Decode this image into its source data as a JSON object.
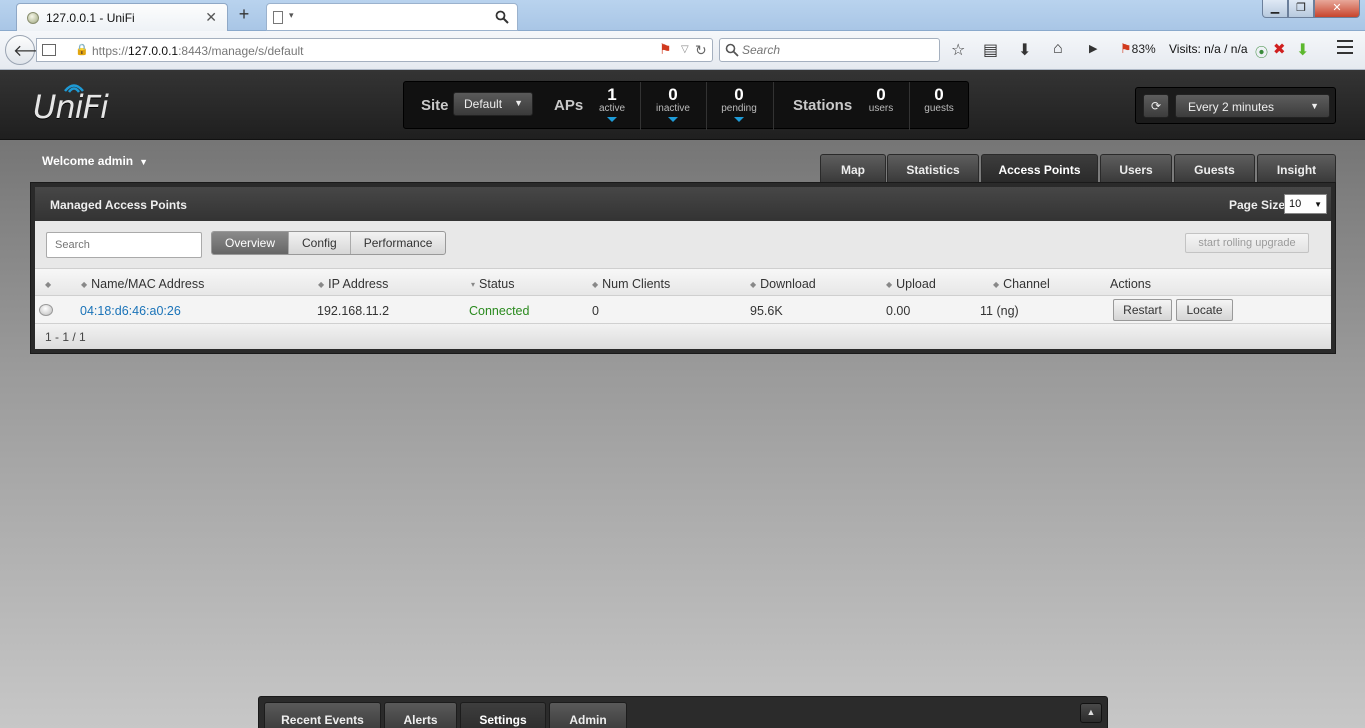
{
  "browser": {
    "tab_title": "127.0.0.1 - UniFi",
    "url_host": "127.0.0.1",
    "url_prefix": "https://",
    "url_suffix": ":8443/manage/s/default",
    "search_placeholder": "Search",
    "zoom_level": "83%",
    "visits_text": "Visits: n/a / n/a"
  },
  "app": {
    "logo_text": "UniFi",
    "site_label": "Site",
    "site_value": "Default",
    "aps_label": "APs",
    "stations_label": "Stations",
    "counts": {
      "active": {
        "num": "1",
        "label": "active"
      },
      "inactive": {
        "num": "0",
        "label": "inactive"
      },
      "pending": {
        "num": "0",
        "label": "pending"
      },
      "users": {
        "num": "0",
        "label": "users"
      },
      "guests": {
        "num": "0",
        "label": "guests"
      }
    },
    "refresh_value": "Every 2 minutes",
    "welcome_text": "Welcome admin",
    "main_tabs": [
      "Map",
      "Statistics",
      "Access Points",
      "Users",
      "Guests",
      "Insight"
    ],
    "active_main_tab": "Access Points"
  },
  "panel": {
    "title": "Managed Access Points",
    "page_size_label": "Page Size",
    "page_size_value": "10",
    "search_placeholder": "Search",
    "view_tabs": [
      "Overview",
      "Config",
      "Performance"
    ],
    "rolling_upgrade_label": "start rolling upgrade",
    "columns": [
      "Name/MAC Address",
      "IP Address",
      "Status",
      "Num Clients",
      "Download",
      "Upload",
      "Channel",
      "Actions"
    ],
    "rows": [
      {
        "name": "04:18:d6:46:a0:26",
        "ip": "192.168.11.2",
        "status": "Connected",
        "num_clients": "0",
        "download": "95.6K",
        "upload": "0.00",
        "channel": "11 (ng)",
        "actions": [
          "Restart",
          "Locate"
        ]
      }
    ],
    "pagination": "1 - 1 / 1"
  },
  "bottom_tabs": [
    "Recent Events",
    "Alerts",
    "Settings",
    "Admin"
  ],
  "colors": {
    "link": "#1a73b8",
    "status_connected": "#2a8a1e",
    "accent_blue": "#1e9bd7"
  }
}
